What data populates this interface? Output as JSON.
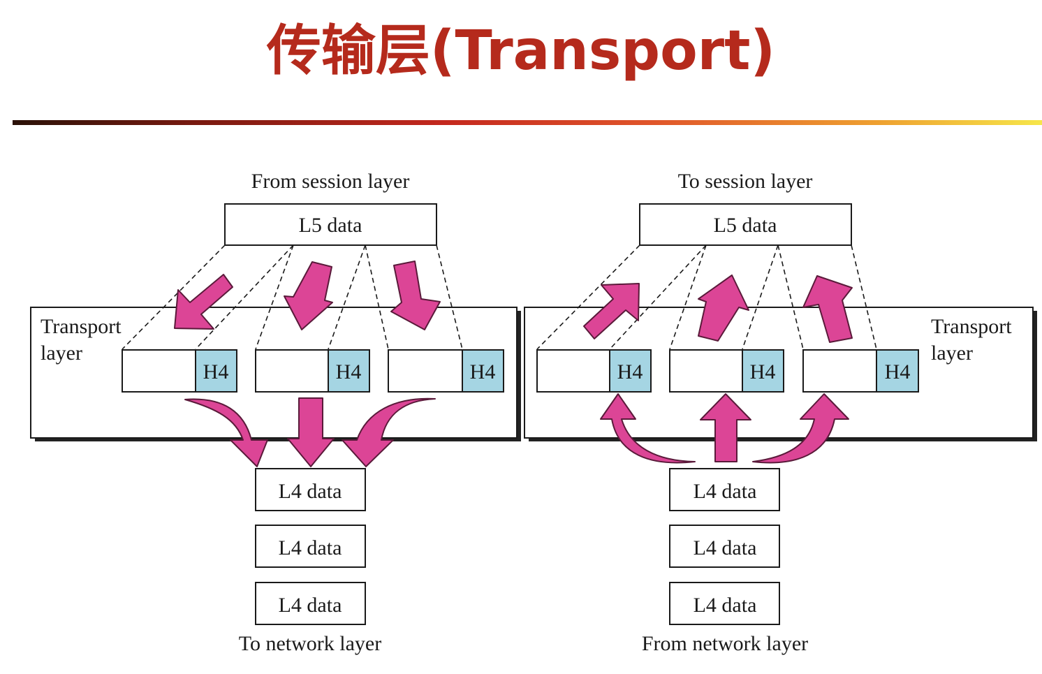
{
  "title": "传输层(Transport)",
  "colors": {
    "title": "#b52a1c",
    "header_box": "#a5d5e3",
    "arrow": "#dc4596"
  },
  "left_panel": {
    "top_label": "From session layer",
    "l5_label": "L5 data",
    "layer_label_line1": "Transport",
    "layer_label_line2": "layer",
    "segment_headers": [
      "H4",
      "H4",
      "H4"
    ],
    "l4_labels": [
      "L4 data",
      "L4 data",
      "L4 data"
    ],
    "bottom_label": "To network layer"
  },
  "right_panel": {
    "top_label": "To session layer",
    "l5_label": "L5 data",
    "layer_label_line1": "Transport",
    "layer_label_line2": "layer",
    "segment_headers": [
      "H4",
      "H4",
      "H4"
    ],
    "l4_labels": [
      "L4 data",
      "L4 data",
      "L4 data"
    ],
    "bottom_label": "From network layer"
  }
}
